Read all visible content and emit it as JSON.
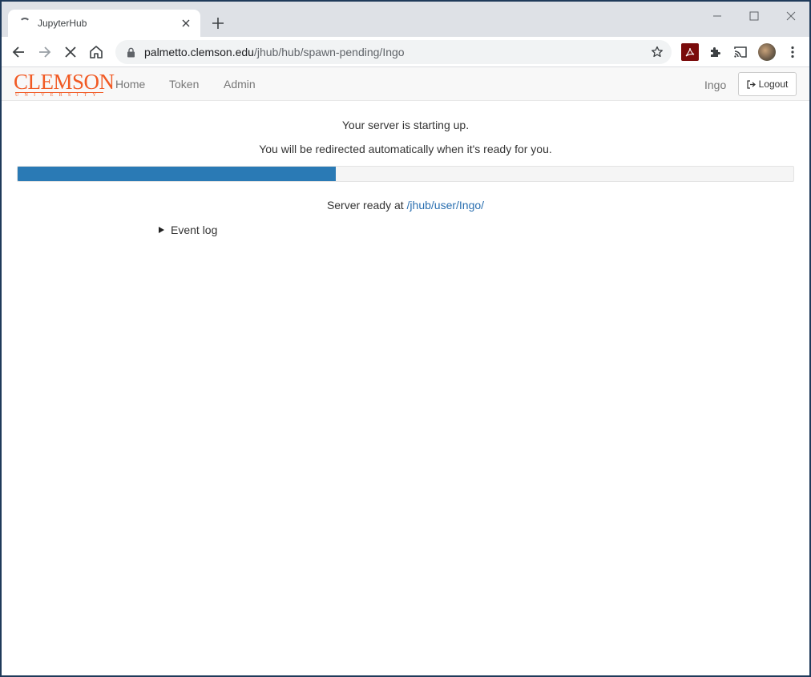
{
  "browser": {
    "tab": {
      "title": "JupyterHub"
    },
    "address": {
      "domain": "palmetto.clemson.edu",
      "path": "/jhub/hub/spawn-pending/Ingo"
    }
  },
  "navbar": {
    "logo_word": "CLEMSON",
    "logo_sub": "UNIVERSITY",
    "links": [
      "Home",
      "Token",
      "Admin"
    ],
    "user": "Ingo",
    "logout_label": "Logout"
  },
  "main": {
    "status_line": "Your server is starting up.",
    "redirect_line": "You will be redirected automatically when it's ready for you.",
    "progress": {
      "percent": 41
    },
    "ready_prefix": "Server ready at",
    "ready_link": "/jhub/user/Ingo/",
    "event_log_label": "Event log"
  },
  "colors": {
    "progress_fill": "#2a7ab5",
    "brand": "#f15a24",
    "link": "#2a6fb0"
  }
}
